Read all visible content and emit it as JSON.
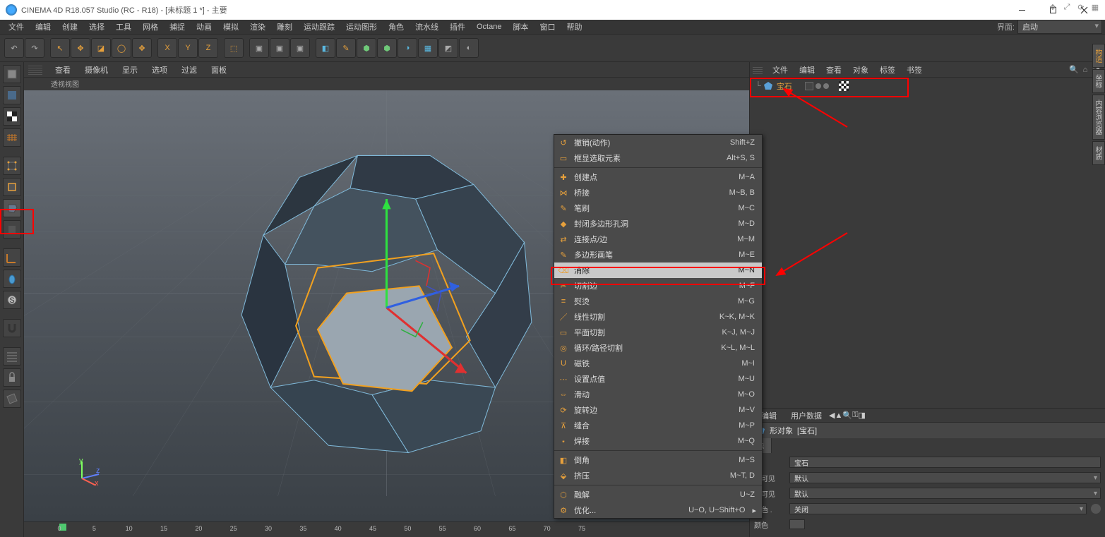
{
  "titlebar": {
    "title": "CINEMA 4D R18.057 Studio (RC - R18) - [未标题 1 *] - 主要"
  },
  "menubar": {
    "items": [
      "文件",
      "编辑",
      "创建",
      "选择",
      "工具",
      "网格",
      "捕捉",
      "动画",
      "模拟",
      "渲染",
      "雕刻",
      "运动跟踪",
      "运动图形",
      "角色",
      "流水线",
      "插件",
      "Octane",
      "脚本",
      "窗口",
      "帮助"
    ],
    "layout_label": "界面:",
    "layout_value": "启动"
  },
  "vpmenu": {
    "items": [
      "查看",
      "摄像机",
      "显示",
      "选项",
      "过滤",
      "面板"
    ],
    "title": "透视视图"
  },
  "timeline": {
    "start": 0,
    "end": 75,
    "step": 5
  },
  "objmenu": {
    "items": [
      "文件",
      "编辑",
      "查看",
      "对象",
      "标签",
      "书签"
    ]
  },
  "object": {
    "name": "宝石"
  },
  "attrmenu": {
    "items": [
      "编辑",
      "用户数据"
    ]
  },
  "attrs": {
    "title_prefix": "形对象",
    "title_obj": "[宝石]",
    "tab0": "标",
    "label_name": "",
    "name_value": "宝石",
    "label_vis1": "器可见",
    "vis1_value": "默认",
    "label_vis2": "器可见",
    "vis2_value": "默认",
    "label_color": "颜色 .",
    "color_value": "关闭",
    "label_colorchip": "颜色"
  },
  "ctx": {
    "items": [
      {
        "icon": "↺",
        "label": "撤销(动作)",
        "sc": "Shift+Z"
      },
      {
        "icon": "▭",
        "label": "框显选取元素",
        "sc": "Alt+S, S"
      },
      {
        "sep": true
      },
      {
        "icon": "✚",
        "label": "创建点",
        "sc": "M~A"
      },
      {
        "icon": "⋈",
        "label": "桥接",
        "sc": "M~B, B"
      },
      {
        "icon": "✎",
        "label": "笔刷",
        "sc": "M~C"
      },
      {
        "icon": "◆",
        "label": "封闭多边形孔洞",
        "sc": "M~D"
      },
      {
        "icon": "⇄",
        "label": "连接点/边",
        "sc": "M~M"
      },
      {
        "icon": "✎",
        "label": "多边形画笔",
        "sc": "M~E"
      },
      {
        "icon": "⌫",
        "label": "消除",
        "sc": "M~N",
        "hl": true
      },
      {
        "icon": "✂",
        "label": "切割边",
        "sc": "M~F"
      },
      {
        "icon": "≡",
        "label": "熨烫",
        "sc": "M~G"
      },
      {
        "icon": "／",
        "label": "线性切割",
        "sc": "K~K, M~K"
      },
      {
        "icon": "▭",
        "label": "平面切割",
        "sc": "K~J, M~J"
      },
      {
        "icon": "◎",
        "label": "循环/路径切割",
        "sc": "K~L, M~L"
      },
      {
        "icon": "U",
        "label": "磁铁",
        "sc": "M~I"
      },
      {
        "icon": "⋯",
        "label": "设置点值",
        "sc": "M~U"
      },
      {
        "icon": "⇔",
        "label": "滑动",
        "sc": "M~O"
      },
      {
        "icon": "⟳",
        "label": "旋转边",
        "sc": "M~V"
      },
      {
        "icon": "⊼",
        "label": "缝合",
        "sc": "M~P"
      },
      {
        "icon": "⋆",
        "label": "焊接",
        "sc": "M~Q"
      },
      {
        "sep": true
      },
      {
        "icon": "◧",
        "label": "倒角",
        "sc": "M~S"
      },
      {
        "icon": "⬙",
        "label": "挤压",
        "sc": "M~T, D"
      },
      {
        "sep": true
      },
      {
        "icon": "⬡",
        "label": "融解",
        "sc": "U~Z"
      },
      {
        "icon": "⚙",
        "label": "优化...",
        "sc": "U~O, U~Shift+O",
        "arrow": true
      }
    ]
  },
  "vtabs": [
    "构造",
    "坐标",
    "内容浏览器",
    "材质"
  ]
}
